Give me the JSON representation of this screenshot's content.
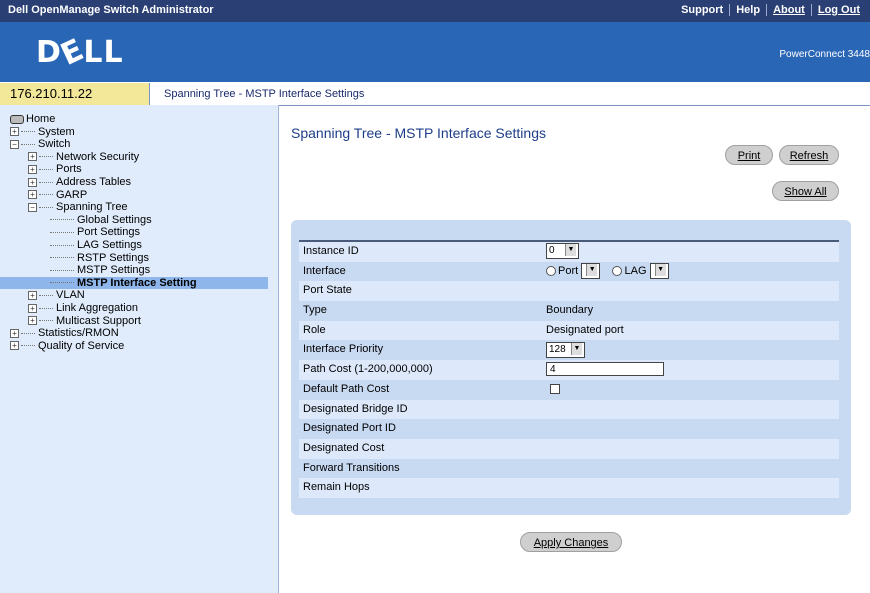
{
  "topbar": {
    "title": "Dell OpenManage Switch Administrator",
    "links": [
      "Support",
      "Help",
      "About",
      "Log Out"
    ]
  },
  "banner": {
    "logo": "D LL",
    "model": "PowerConnect 3448"
  },
  "addressbar": {
    "ip": "176.210.11.22",
    "breadcrumb": "Spanning Tree - MSTP Interface Settings"
  },
  "tree": {
    "home": "Home",
    "system": "System",
    "switch": "Switch",
    "network_security": "Network Security",
    "ports": "Ports",
    "address_tables": "Address Tables",
    "garp": "GARP",
    "spanning_tree": "Spanning Tree",
    "global_settings": "Global Settings",
    "port_settings": "Port Settings",
    "lag_settings": "LAG Settings",
    "rstp_settings": "RSTP Settings",
    "mstp_settings": "MSTP Settings",
    "mstp_interface_setting": "MSTP Interface Setting",
    "vlan": "VLAN",
    "link_aggregation": "Link Aggregation",
    "multicast_support": "Multicast Support",
    "statistics": "Statistics/RMON",
    "qos": "Quality of Service"
  },
  "main": {
    "title": "Spanning Tree - MSTP Interface Settings",
    "print": "Print",
    "refresh": "Refresh",
    "show_all": "Show All",
    "apply": "Apply Changes"
  },
  "form": {
    "instance_id_label": "Instance ID",
    "instance_id_value": "0",
    "interface_label": "Interface",
    "port_radio": "Port",
    "lag_radio": "LAG",
    "port_state_label": "Port State",
    "type_label": "Type",
    "type_value": "Boundary",
    "role_label": "Role",
    "role_value": "Designated port",
    "priority_label": "Interface Priority",
    "priority_value": "128",
    "path_cost_label": "Path Cost (1-200,000,000)",
    "path_cost_value": "4",
    "default_path_cost_label": "Default Path Cost",
    "bridge_id_label": "Designated Bridge ID",
    "port_id_label": "Designated Port ID",
    "cost_label": "Designated Cost",
    "fwd_label": "Forward Transitions",
    "hops_label": "Remain Hops"
  },
  "colors": {
    "topbar": "#2a3f73",
    "banner": "#2a66b6",
    "sidebar": "#e0ecfb",
    "panel": "#c8d9f2",
    "ip_bg": "#f3e79a"
  }
}
